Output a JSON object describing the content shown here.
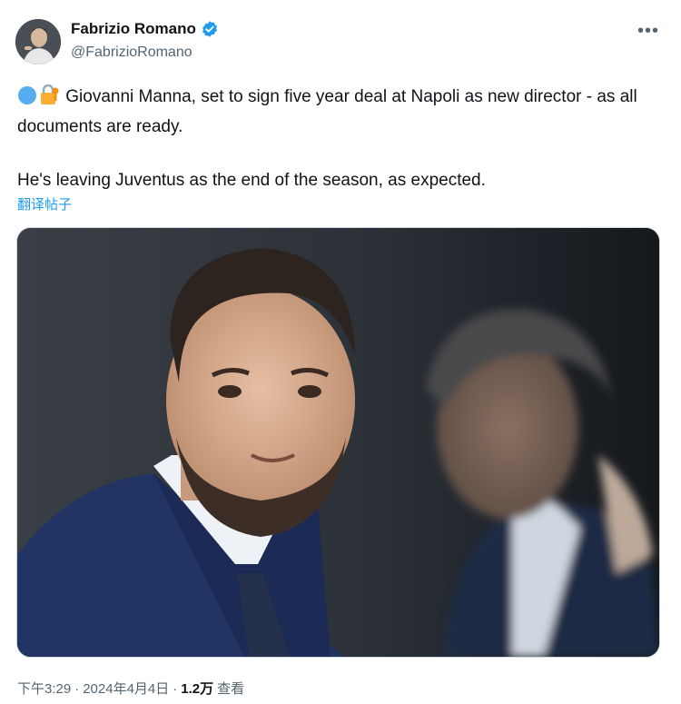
{
  "author": {
    "name": "Fabrizio Romano",
    "handle": "@FabrizioRomano",
    "verified_color": "#1d9bf0"
  },
  "more_icon": "more-horizontal-icon",
  "tweet": {
    "emojis": [
      "blue-circle-emoji",
      "locked-with-key-emoji"
    ],
    "line1": "Giovanni Manna, set to sign five year deal at Napoli as new director - as all documents are ready.",
    "line2": "He's leaving Juventus as the end of the season, as expected.",
    "translate_link": "翻译帖子"
  },
  "media": {
    "description_icon": "photo"
  },
  "footer": {
    "time": "下午3:29",
    "sep1": "·",
    "date": "2024年4月4日",
    "sep2": "·",
    "views": "1.2万",
    "views_label": "查看"
  },
  "colors": {
    "link": "#1d9bf0",
    "secondary_text": "#536471",
    "primary_text": "#0f1419"
  }
}
